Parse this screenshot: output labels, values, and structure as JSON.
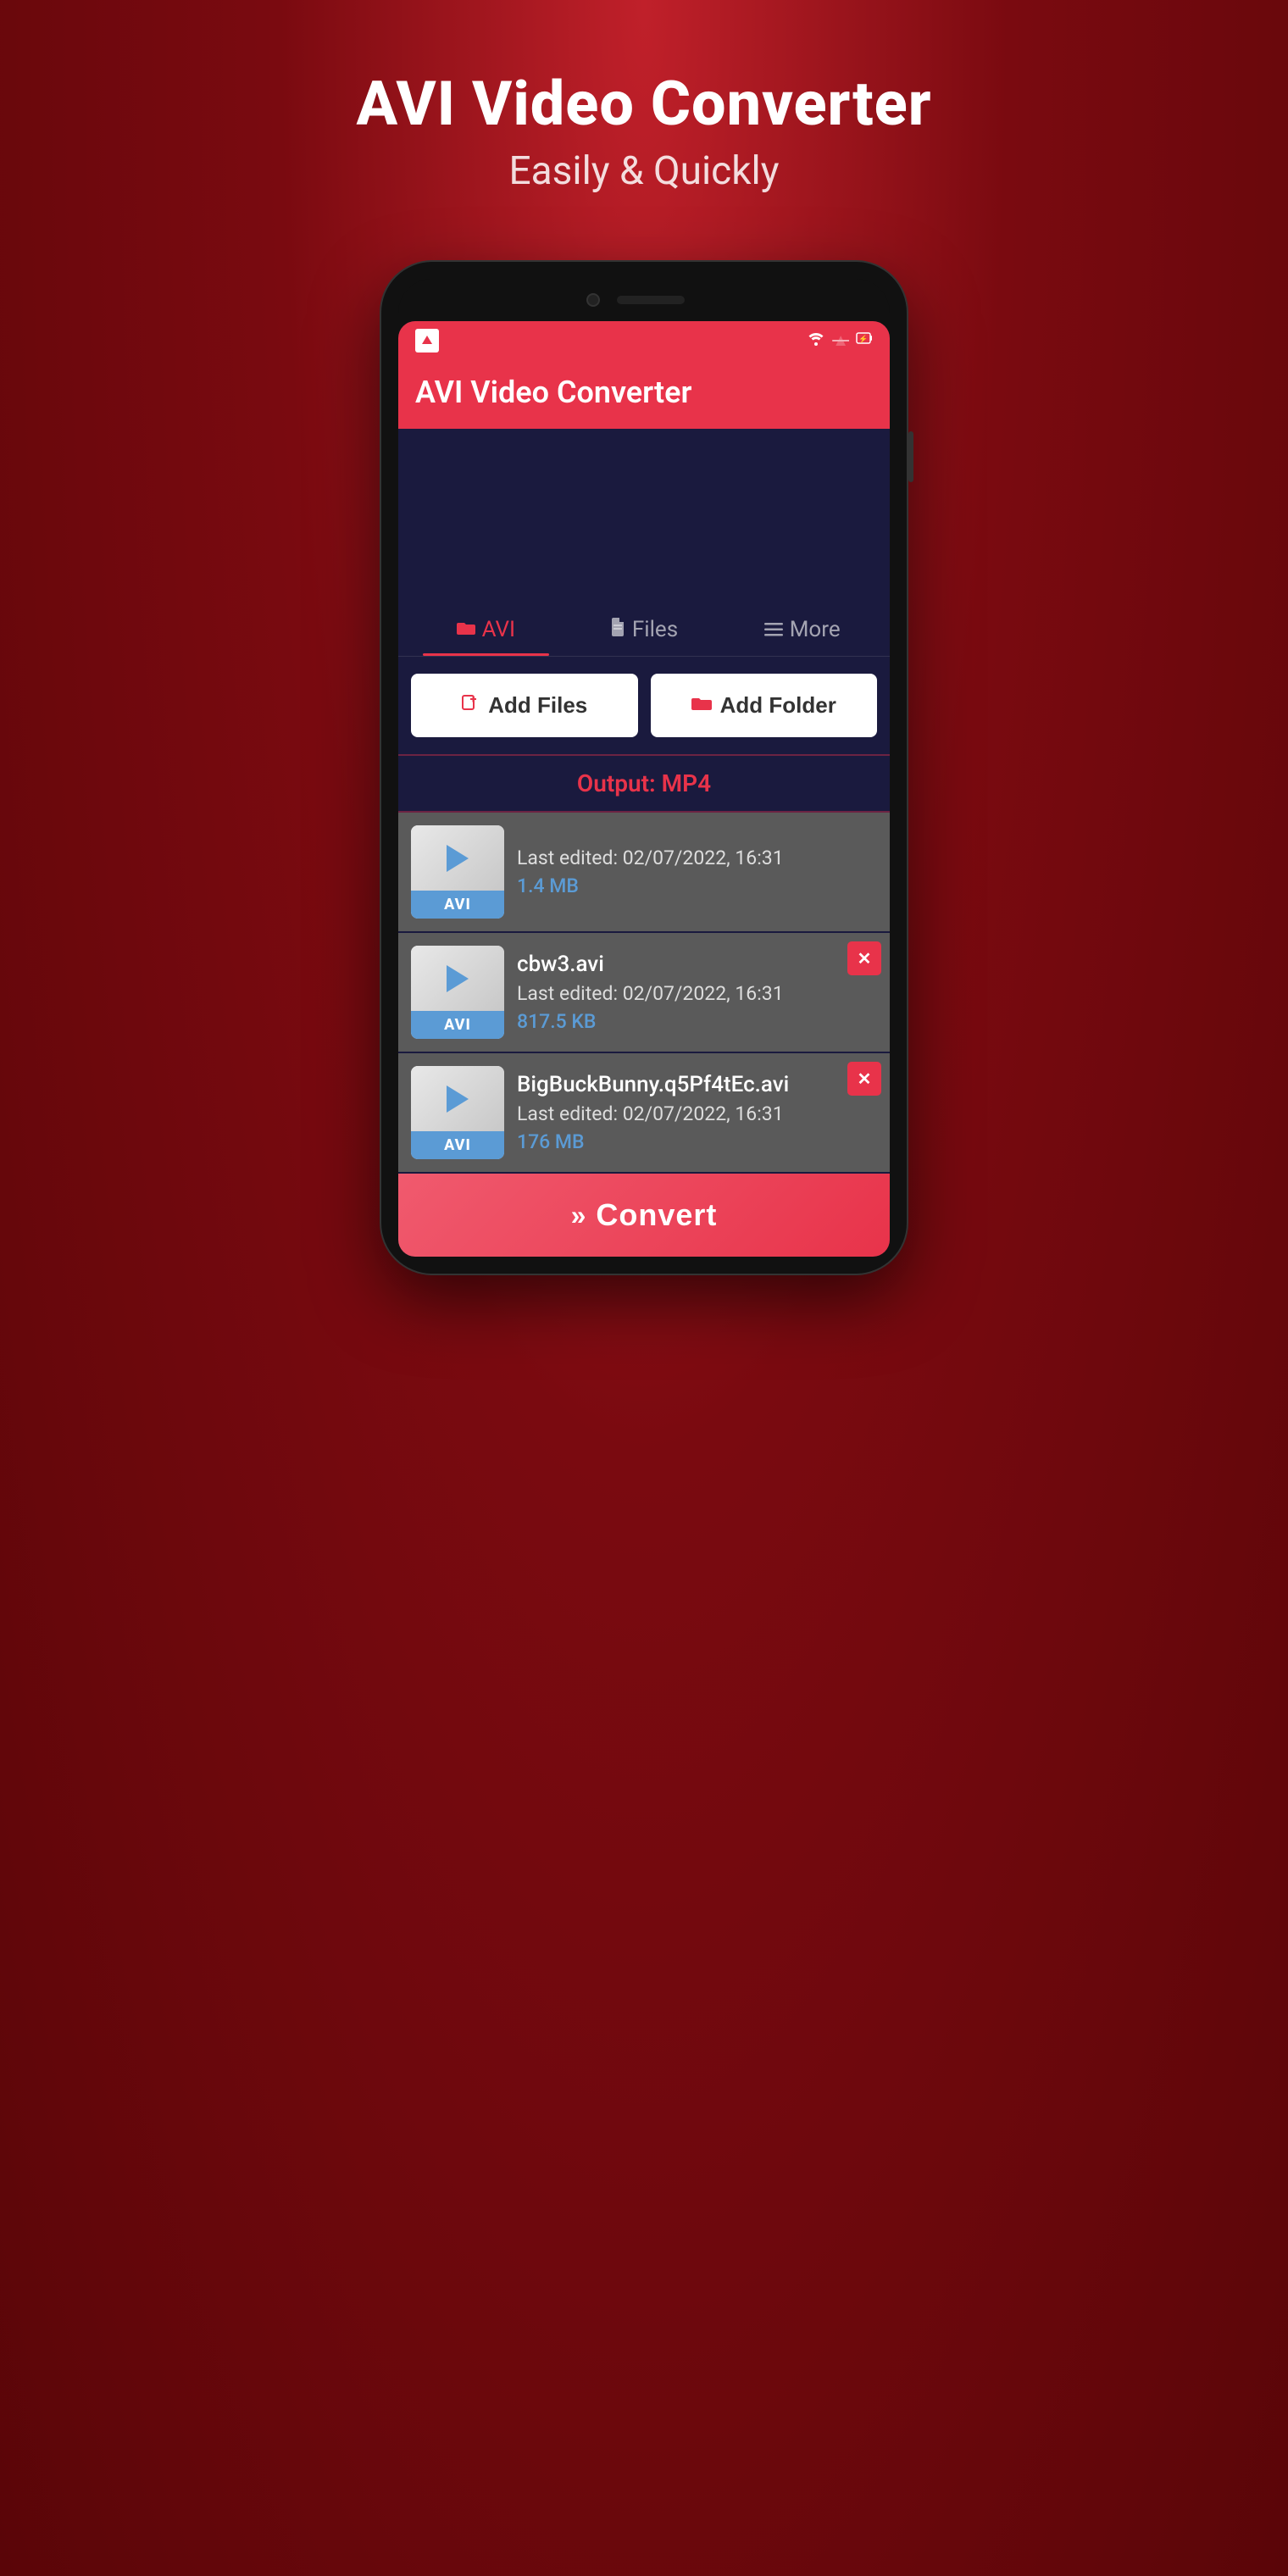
{
  "header": {
    "title": "AVI Video Converter",
    "subtitle": "Easily & Quickly"
  },
  "app_bar": {
    "title": "AVI Video Converter"
  },
  "tabs": [
    {
      "id": "avi",
      "label": "AVI",
      "icon": "📂",
      "active": true
    },
    {
      "id": "files",
      "label": "Files",
      "icon": "📄",
      "active": false
    },
    {
      "id": "more",
      "label": "More",
      "icon": "☰",
      "active": false
    }
  ],
  "buttons": {
    "add_files": "Add Files",
    "add_folder": "Add Folder"
  },
  "output": {
    "label": "Output: MP4"
  },
  "files": [
    {
      "name": "",
      "date": "Last edited: 02/07/2022, 16:31",
      "size": "1.4 MB",
      "format": "AVI",
      "has_delete": false
    },
    {
      "name": "cbw3.avi",
      "date": "Last edited: 02/07/2022, 16:31",
      "size": "817.5 KB",
      "format": "AVI",
      "has_delete": true
    },
    {
      "name": "BigBuckBunny.q5Pf4tEc.avi",
      "date": "Last edited: 02/07/2022, 16:31",
      "size": "176 MB",
      "format": "AVI",
      "has_delete": true
    }
  ],
  "convert_button": {
    "label": "Convert",
    "arrows": "»"
  },
  "status_bar": {
    "wifi": "▼",
    "signal": "▲",
    "battery": "⚡"
  }
}
